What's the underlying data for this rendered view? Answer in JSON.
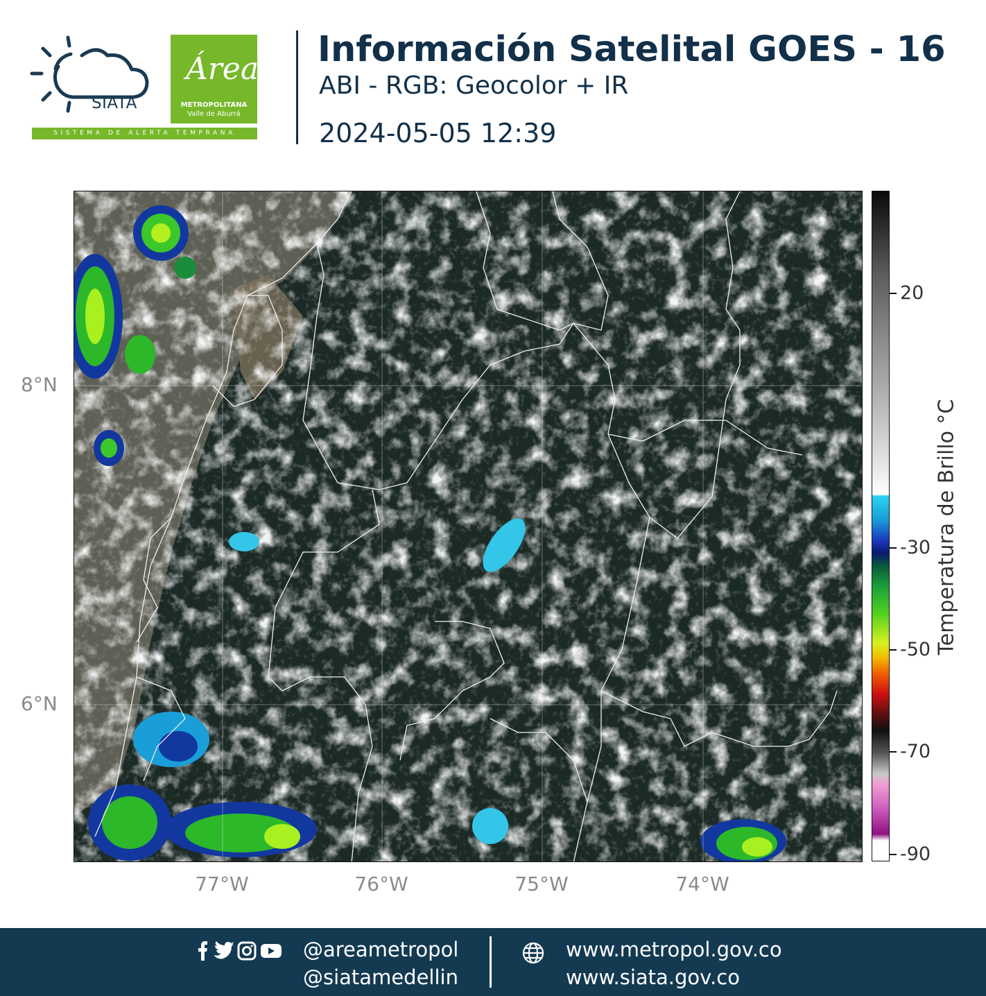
{
  "header": {
    "siata_logo_text": "SIATA",
    "area_logo_script": "Área",
    "area_logo_line1": "METROPOLITANA",
    "area_logo_line2": "Valle de Aburrá",
    "alert_system_text": "SISTEMA DE ALERTA TEMPRANA",
    "title": "Información Satelital GOES - 16",
    "subtitle": "ABI - RGB: Geocolor + IR",
    "datetime": "2024-05-05 12:39"
  },
  "map": {
    "y_tick_labels": [
      "8°N",
      "6°N"
    ],
    "x_tick_labels": [
      "77°W",
      "76°W",
      "75°W",
      "74°W"
    ],
    "gridlines": true
  },
  "colorbar": {
    "title": "Temperatura de Brillo °C",
    "tick_labels": [
      "20",
      "-30",
      "-50",
      "-70",
      "-90"
    ]
  },
  "footer": {
    "icons": [
      "facebook-icon",
      "twitter-icon",
      "instagram-icon",
      "youtube-icon",
      "globe-icon"
    ],
    "handle_1": "@areametropol",
    "handle_2": "@siatamedellin",
    "website_1": "www.metropol.gov.co",
    "website_2": "www.siata.gov.co"
  }
}
